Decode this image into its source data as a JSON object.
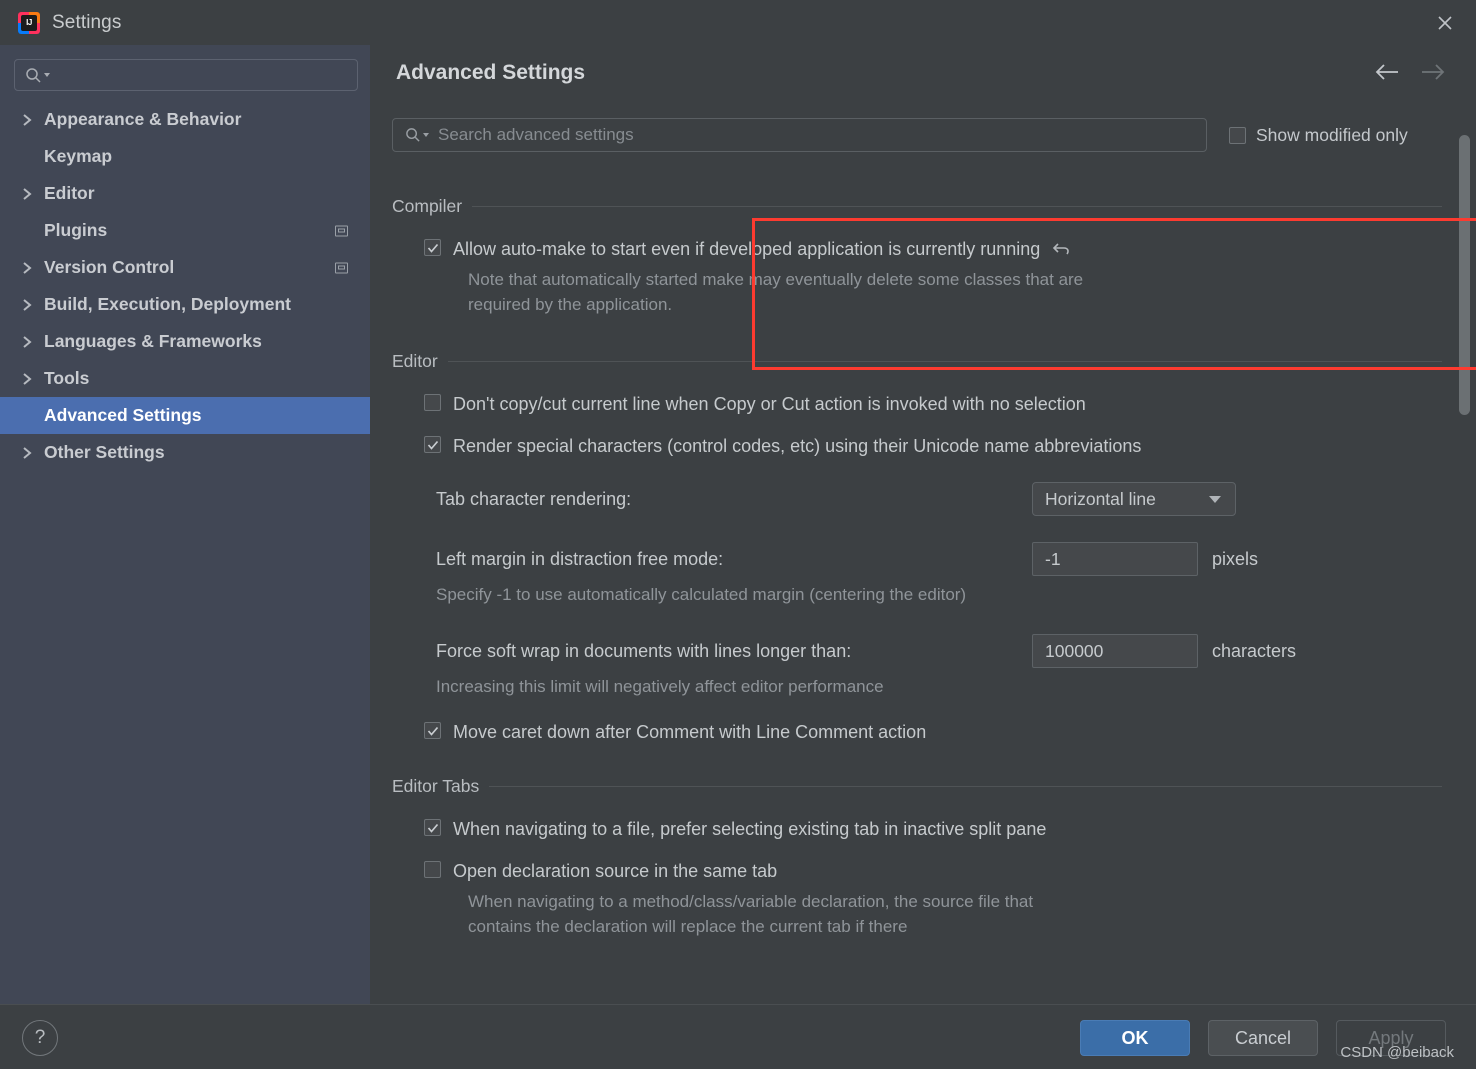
{
  "window": {
    "title": "Settings",
    "logo_text": "IJ",
    "close_icon": "close-icon"
  },
  "sidebar": {
    "search_placeholder": "",
    "items": [
      {
        "label": "Appearance & Behavior",
        "expandable": true,
        "selected": false,
        "badge": false
      },
      {
        "label": "Keymap",
        "expandable": false,
        "selected": false,
        "badge": false
      },
      {
        "label": "Editor",
        "expandable": true,
        "selected": false,
        "badge": false
      },
      {
        "label": "Plugins",
        "expandable": false,
        "selected": false,
        "badge": true
      },
      {
        "label": "Version Control",
        "expandable": true,
        "selected": false,
        "badge": true
      },
      {
        "label": "Build, Execution, Deployment",
        "expandable": true,
        "selected": false,
        "badge": false
      },
      {
        "label": "Languages & Frameworks",
        "expandable": true,
        "selected": false,
        "badge": false
      },
      {
        "label": "Tools",
        "expandable": true,
        "selected": false,
        "badge": false
      },
      {
        "label": "Advanced Settings",
        "expandable": false,
        "selected": true,
        "badge": false
      },
      {
        "label": "Other Settings",
        "expandable": true,
        "selected": false,
        "badge": false
      }
    ]
  },
  "header": {
    "title": "Advanced Settings",
    "back_icon": "arrow-left-icon",
    "forward_icon": "arrow-right-icon"
  },
  "search": {
    "placeholder": "Search advanced settings",
    "value": "",
    "icon": "search-icon"
  },
  "show_modified": {
    "label": "Show modified only",
    "checked": false
  },
  "groups": [
    {
      "title": "Compiler",
      "highlighted": true,
      "rows": [
        {
          "kind": "checkbox",
          "checked": true,
          "label": "Allow auto-make to start even if developed application is currently running",
          "revert": true,
          "revert_icon": "revert-arrow-icon",
          "note": "Note that automatically started make may eventually delete some classes that are required by the application."
        }
      ]
    },
    {
      "title": "Editor",
      "highlighted": false,
      "rows": [
        {
          "kind": "checkbox",
          "checked": false,
          "label": "Don't copy/cut current line when Copy or Cut action is invoked with no selection",
          "revert": false
        },
        {
          "kind": "checkbox",
          "checked": true,
          "label": "Render special characters (control codes, etc) using their Unicode name abbreviations",
          "revert": false
        },
        {
          "kind": "combo",
          "label": "Tab character rendering:",
          "value": "Horizontal line",
          "caret_icon": "chevron-down-icon"
        },
        {
          "kind": "number",
          "label": "Left margin in distraction free mode:",
          "value": "-1",
          "unit": "pixels",
          "note": "Specify -1 to use automatically calculated margin (centering the editor)"
        },
        {
          "kind": "number",
          "label": "Force soft wrap in documents with lines longer than:",
          "value": "100000",
          "unit": "characters",
          "note": "Increasing this limit will negatively affect editor performance"
        },
        {
          "kind": "checkbox",
          "checked": true,
          "label": "Move caret down after Comment with Line Comment action",
          "revert": false
        }
      ]
    },
    {
      "title": "Editor Tabs",
      "highlighted": false,
      "rows": [
        {
          "kind": "checkbox",
          "checked": true,
          "label": "When navigating to a file, prefer selecting existing tab in inactive split pane",
          "revert": false
        },
        {
          "kind": "checkbox",
          "checked": false,
          "label": "Open declaration source in the same tab",
          "revert": false,
          "note": "When navigating to a method/class/variable declaration, the source file that contains the declaration will replace the current tab if there"
        }
      ]
    }
  ],
  "footer": {
    "help_label": "?",
    "ok_label": "OK",
    "cancel_label": "Cancel",
    "apply_label": "Apply"
  },
  "watermark": "CSDN @beiback",
  "colors": {
    "accent": "#4b6eaf",
    "primary_button": "#3b6ea8",
    "highlight_border": "#fd3b30",
    "sidebar_bg": "#414755",
    "main_bg": "#3c4043"
  }
}
